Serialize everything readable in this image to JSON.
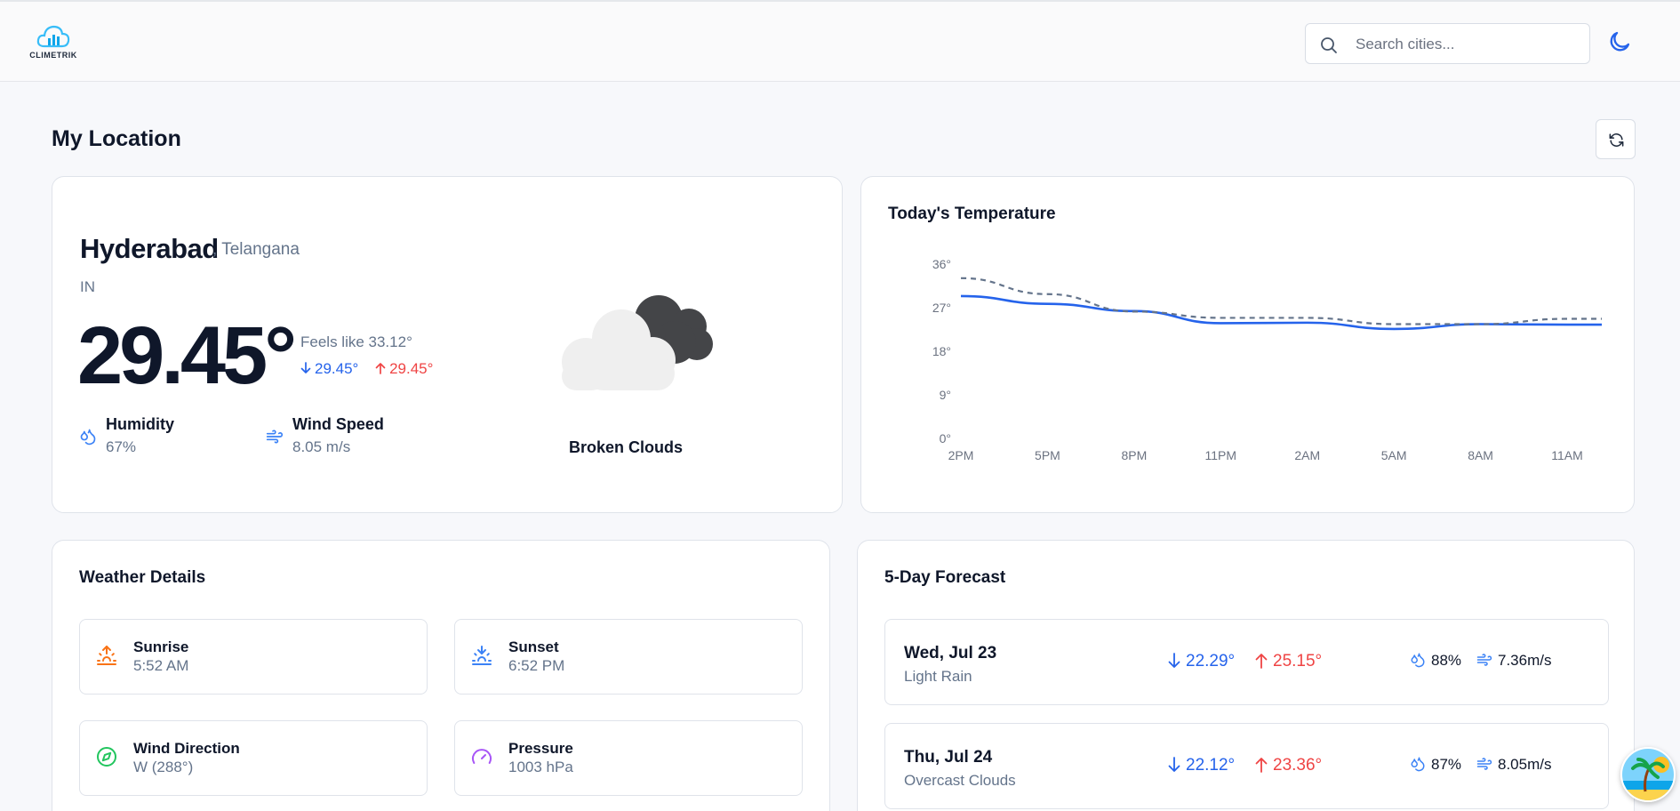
{
  "app": {
    "logo_text": "CLIMETRIK"
  },
  "header": {
    "search_placeholder": "Search cities...",
    "theme_icon": "moon-icon"
  },
  "page": {
    "title": "My Location",
    "refresh_icon": "refresh-icon"
  },
  "current": {
    "city": "Hyderabad",
    "state": ", Telangana",
    "country": "IN",
    "temp": "29.45°",
    "feels_like": "Feels like 33.12°",
    "min": "29.45°",
    "max": "29.45°",
    "humidity_label": "Humidity",
    "humidity_value": "67%",
    "wind_label": "Wind Speed",
    "wind_value": "8.05 m/s",
    "condition": "Broken Clouds",
    "condition_icon": "broken-clouds-icon"
  },
  "chart_title": "Today's Temperature",
  "chart_data": {
    "type": "line",
    "categories": [
      "2PM",
      "5PM",
      "8PM",
      "11PM",
      "2AM",
      "5AM",
      "8AM",
      "11AM"
    ],
    "y_ticks": [
      "36°",
      "27°",
      "18°",
      "9°",
      "0°"
    ],
    "ylim": [
      0,
      36
    ],
    "grid": false,
    "series": [
      {
        "style": "solid",
        "color": "#2563eb",
        "values": [
          29.4,
          27.8,
          26.3,
          23.8,
          23.9,
          22.6,
          23.6,
          23.5
        ]
      },
      {
        "style": "dashed",
        "color": "#64748b",
        "values": [
          33.1,
          29.8,
          26.2,
          24.9,
          24.9,
          23.6,
          23.6,
          24.7
        ]
      }
    ]
  },
  "details": {
    "title": "Weather Details",
    "items": [
      {
        "label": "Sunrise",
        "value": "5:52 AM",
        "icon": "sunrise-icon",
        "color": "#f97316"
      },
      {
        "label": "Sunset",
        "value": "6:52 PM",
        "icon": "sunset-icon",
        "color": "#3b82f6"
      },
      {
        "label": "Wind Direction",
        "value": "W (288°)",
        "icon": "compass-icon",
        "color": "#22c55e"
      },
      {
        "label": "Pressure",
        "value": "1003 hPa",
        "icon": "gauge-icon",
        "color": "#a855f7"
      }
    ]
  },
  "forecast": {
    "title": "5-Day Forecast",
    "days": [
      {
        "day": "Wed, Jul 23",
        "desc": "Light Rain",
        "min": "22.29°",
        "max": "25.15°",
        "humidity": "88%",
        "wind": "7.36m/s"
      },
      {
        "day": "Thu, Jul 24",
        "desc": "Overcast Clouds",
        "min": "22.12°",
        "max": "23.36°",
        "humidity": "87%",
        "wind": "8.05m/s"
      }
    ]
  },
  "colors": {
    "accent": "#2563eb",
    "min": "#2563eb",
    "max": "#ef4444",
    "muted": "#64748b"
  }
}
